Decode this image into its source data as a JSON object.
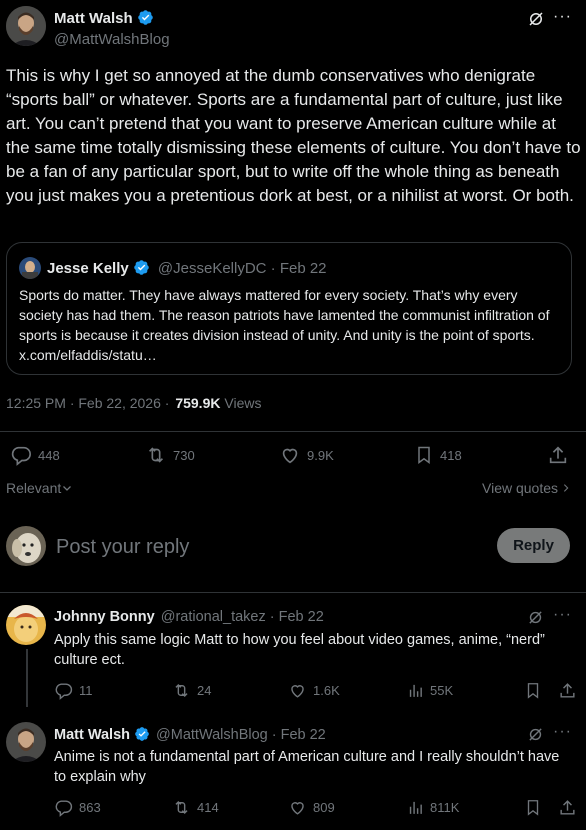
{
  "main_post": {
    "author_name": "Matt Walsh",
    "author_handle": "@MattWalshBlog",
    "body": "This is why I get so annoyed at the dumb conservatives who denigrate “sports ball” or whatever. Sports are a fundamental part of culture, just like art. You can’t pretend that you want to preserve American culture while at the same time totally dismissing these elements of culture. You don’t have to be a fan of any particular sport, but to write off the whole thing as beneath you just makes you a pretentious dork at best, or a nihilist at worst. Or both.",
    "timestamp": "12:25 PM · Feb 22, 2026 ·",
    "views_count": "759.9K",
    "views_label": "Views",
    "replies": "448",
    "reposts": "730",
    "likes": "9.9K",
    "bookmarks": "418"
  },
  "quoted_post": {
    "author_name": "Jesse Kelly",
    "author_handle": "@JesseKellyDC · Feb 22",
    "body": "Sports do matter. They have always mattered for every society. That’s why every society has had them. The reason patriots have lamented the communist infiltration of sports is because it creates division instead of unity. And unity is the point of sports. x.com/elfaddis/statu…"
  },
  "filters": {
    "sort_label": "Relevant",
    "view_quotes_label": "View quotes"
  },
  "composer": {
    "placeholder": "Post your reply",
    "reply_button": "Reply"
  },
  "replies": [
    {
      "author_name": "Johnny Bonny",
      "author_handle": "@rational_takez · Feb 22",
      "body": "Apply this same logic Matt to how you feel about video games, anime, “nerd” culture ect.",
      "replies": "11",
      "reposts": "24",
      "likes": "1.6K",
      "views": "55K"
    },
    {
      "author_name": "Matt Walsh",
      "author_handle": "@MattWalshBlog · Feb 22",
      "body": "Anime is not a fundamental part of American culture and I really shouldn’t have to explain why",
      "replies": "863",
      "reposts": "414",
      "likes": "809",
      "views": "811K"
    }
  ],
  "colors": {
    "background": "#000000",
    "verified": "#1d9bf0",
    "text": "#e7e9ea",
    "muted": "#71767b",
    "border": "#2f3336"
  }
}
